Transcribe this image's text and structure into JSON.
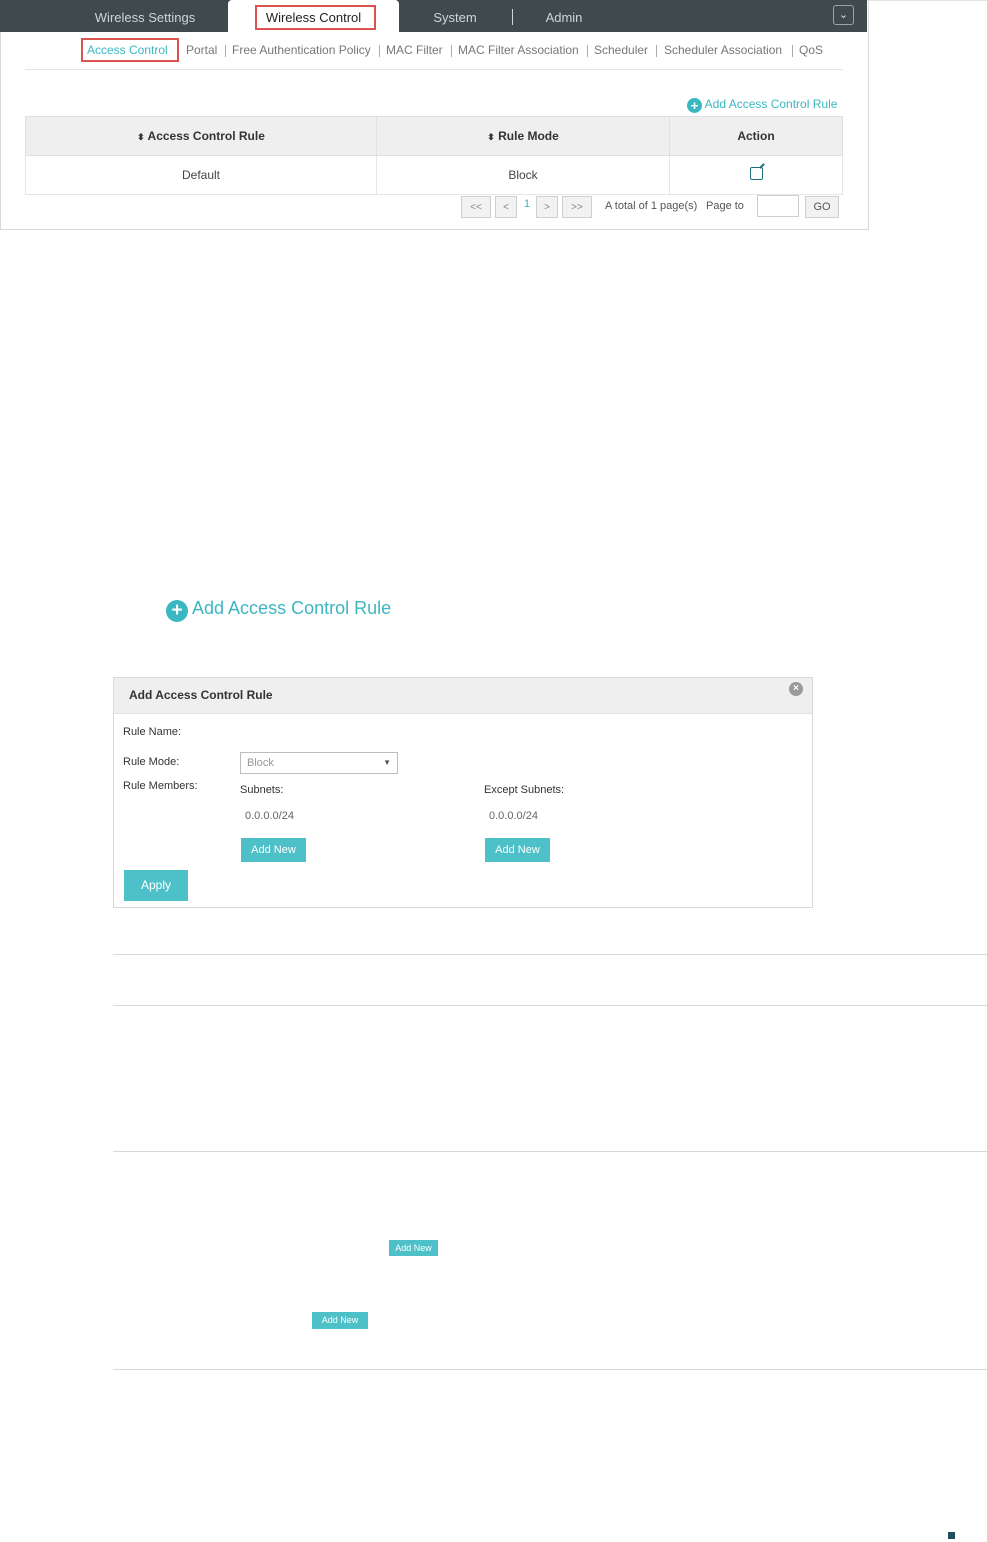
{
  "nav": {
    "tabs": [
      {
        "label": "Wireless Settings"
      },
      {
        "label": "Wireless Control",
        "active": true
      },
      {
        "label": "System"
      },
      {
        "label": "Admin"
      }
    ]
  },
  "subnav": {
    "items": [
      {
        "label": "Access Control",
        "active": true
      },
      {
        "label": "Portal"
      },
      {
        "label": "Free Authentication Policy"
      },
      {
        "label": "MAC Filter"
      },
      {
        "label": "MAC Filter Association"
      },
      {
        "label": "Scheduler"
      },
      {
        "label": "Scheduler Association"
      },
      {
        "label": "QoS"
      }
    ]
  },
  "add_rule_link": "Add Access Control Rule",
  "table": {
    "headers": [
      "Access Control Rule",
      "Rule Mode",
      "Action"
    ],
    "rows": [
      {
        "rule": "Default",
        "mode": "Block",
        "action_icon": "edit-icon"
      }
    ]
  },
  "pagination": {
    "first": "<<",
    "prev": "<",
    "current": "1",
    "next": ">",
    "last": ">>",
    "total": "A total of 1 page(s)",
    "page_to_label": "Page to",
    "page_to_value": "",
    "go": "GO"
  },
  "big_add_link": "Add Access Control Rule",
  "dialog": {
    "title": "Add Access Control Rule",
    "rule_name_label": "Rule Name:",
    "rule_mode_label": "Rule Mode:",
    "rule_mode_value": "Block",
    "rule_members_label": "Rule Members:",
    "subnets_label": "Subnets:",
    "subnets_value": "0.0.0.0/24",
    "except_label": "Except Subnets:",
    "except_value": "0.0.0.0/24",
    "add_new": "Add New",
    "apply": "Apply"
  },
  "inline_buttons": {
    "add_new_1": "Add New",
    "add_new_2": "Add New"
  },
  "colors": {
    "accent": "#3bb7c1",
    "navbar": "#3f4a4c",
    "highlight": "#d9534f"
  }
}
